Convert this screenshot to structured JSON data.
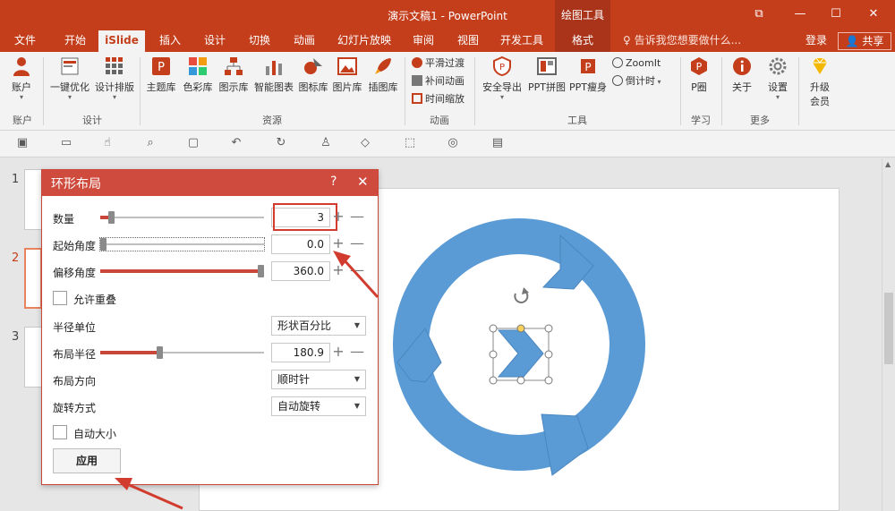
{
  "window": {
    "title": "演示文稿1 - PowerPoint",
    "context_tab": "绘图工具",
    "btn_restore": "⧉",
    "btn_minimize": "—",
    "btn_maximize": "☐",
    "btn_close": "✕"
  },
  "tabs": [
    {
      "label": "文件"
    },
    {
      "label": "开始"
    },
    {
      "label": "iSlide"
    },
    {
      "label": "插入"
    },
    {
      "label": "设计"
    },
    {
      "label": "切换"
    },
    {
      "label": "动画"
    },
    {
      "label": "幻灯片放映"
    },
    {
      "label": "审阅"
    },
    {
      "label": "视图"
    },
    {
      "label": "开发工具"
    },
    {
      "label": "格式"
    }
  ],
  "tell_me": "告诉我您想要做什么...",
  "login": "登录",
  "share": "共享",
  "ribbon": {
    "account": "账户",
    "one_key": "一键优化",
    "design_layout": "设计排版",
    "theme_lib": "主题库",
    "color_lib": "色彩库",
    "diagram_lib": "图示库",
    "smart_chart": "智能图表",
    "icon_lib": "图标库",
    "image_lib": "图片库",
    "illus_lib": "插图库",
    "smooth": "平滑过渡",
    "tween": "补间动画",
    "time_scale": "时间缩放",
    "safe_export": "安全导出",
    "ppt_merge": "PPT拼图",
    "ppt_slim": "PPT瘦身",
    "zoomit": "ZoomIt",
    "countdown": "倒计时",
    "p_circle": "P圈",
    "about": "关于",
    "settings": "设置",
    "upgrade_1": "升级",
    "upgrade_2": "会员",
    "groups": {
      "account": "账户",
      "design": "设计",
      "resources": "资源",
      "animation": "动画",
      "tools": "工具",
      "learn": "学习",
      "more": "更多"
    }
  },
  "slides": [
    {
      "num": "1"
    },
    {
      "num": "2"
    },
    {
      "num": "3"
    }
  ],
  "dialog": {
    "title": "环形布局",
    "help": "?",
    "close": "✕",
    "count_label": "数量",
    "count_value": "3",
    "count_level": 0.05,
    "start_angle_label": "起始角度",
    "start_angle_value": "0.0",
    "start_angle_level": 0.0,
    "offset_angle_label": "偏移角度",
    "offset_angle_value": "360.0",
    "offset_angle_level": 1.0,
    "allow_overlap_label": "允许重叠",
    "radius_unit_label": "半径单位",
    "radius_unit_value": "形状百分比",
    "layout_radius_label": "布局半径",
    "layout_radius_value": "180.9",
    "layout_radius_level": 0.36,
    "layout_direction_label": "布局方向",
    "layout_direction_value": "顺时针",
    "rotation_label": "旋转方式",
    "rotation_value": "自动旋转",
    "auto_size_label": "自动大小",
    "apply_label": "应用",
    "plus": "+",
    "minus": "—"
  },
  "colors": {
    "accent": "#c43e1c",
    "dialog_title": "#cf4b3e",
    "shape_blue": "#5b9bd5",
    "highlight_red": "#d23c2e"
  }
}
